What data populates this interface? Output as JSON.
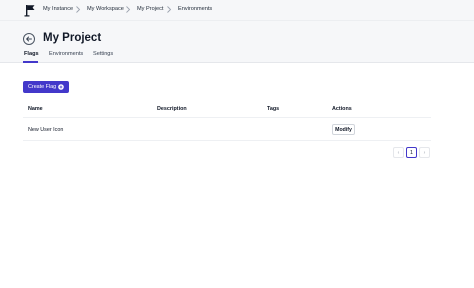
{
  "breadcrumb": {
    "items": [
      "My Instance",
      "My Workspace",
      "My Project",
      "Environments"
    ]
  },
  "header": {
    "title": "My Project",
    "tabs": [
      "Flags",
      "Environments",
      "Settings"
    ]
  },
  "toolbar": {
    "create_label": "Create Flag"
  },
  "table": {
    "columns": [
      "Name",
      "Description",
      "Tags",
      "Actions"
    ],
    "rows": [
      {
        "name": "New User Icon",
        "description": "",
        "tags": "",
        "action_label": "Modify"
      }
    ]
  },
  "pagination": {
    "prev": "‹",
    "current": "1",
    "next": "›"
  },
  "colors": {
    "accent": "#4338ca",
    "header_bg": "#f6f7f9"
  }
}
